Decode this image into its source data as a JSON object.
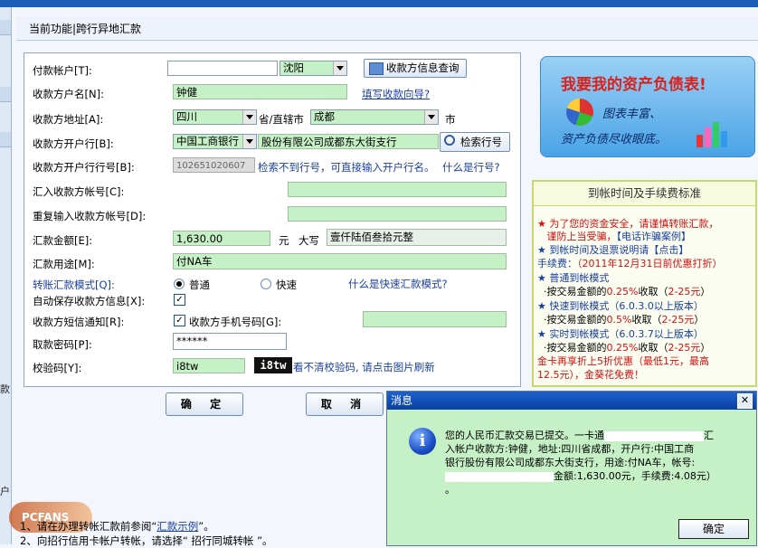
{
  "header": {
    "breadcrumb": "当前功能|跨行异地汇款"
  },
  "left_glyphs": [
    "款",
    "户"
  ],
  "form": {
    "payer_account": {
      "label": "付款帐户[T]:",
      "city": "沈阳",
      "query_button": "收款方信息查询"
    },
    "payee_name": {
      "label": "收款方户名[N]:",
      "value": "钟健",
      "link": "填写收款向导?"
    },
    "payee_address": {
      "label": "收款方地址[A]:",
      "province": "四川",
      "province_suffix": "省/直辖市",
      "city": "成都",
      "city_suffix": "市"
    },
    "payee_bank": {
      "label": "收款方开户行[B]:",
      "bank": "中国工商银行",
      "branch": "股份有限公司成都东大街支行",
      "search_button": "检索行号"
    },
    "payee_bank_no": {
      "label": "收款方开户行行号[B]:",
      "value": "102651020607",
      "hint": "检索不到行号，可直接输入开户行名。",
      "link": "什么是行号?"
    },
    "account_no": {
      "label": "汇入收款方帐号[C]:"
    },
    "account_no_repeat": {
      "label": "重复输入收款方帐号[D]:"
    },
    "amount": {
      "label": "汇款金额[E]:",
      "value": "1,630.00",
      "unit": "元",
      "daxie_label": "大写",
      "daxie_value": "壹仟陆佰叁拾元整"
    },
    "purpose": {
      "label": "汇款用途[M]:",
      "value": "付NA车"
    },
    "mode": {
      "label": "转账汇款模式[Q]:",
      "normal": "普通",
      "fast": "快速",
      "link": "什么是快速汇款模式?"
    },
    "autosave": {
      "label": "自动保存收款方信息[X]:"
    },
    "sms": {
      "label": "收款方短信通知[R]:",
      "phone_label": "收款方手机号码[G]:"
    },
    "password": {
      "label": "取款密码[P]:",
      "value": "******"
    },
    "captcha": {
      "label": "校验码[Y]:",
      "value": "i8tw",
      "image_text": "i8tw",
      "hint": "看不清校验码, 请点击图片刷新"
    },
    "confirm_button": "确 定",
    "cancel_button": "取 消"
  },
  "ad": {
    "headline": "我要我的资产负债表!",
    "line1": "图表丰富、",
    "line2": "资产负债尽收眼底。"
  },
  "fee_box": {
    "title": "到帐时间及手续费标准",
    "lines": [
      "为了您的资金安全，请谨慎转账汇款，",
      "谨防上当受骗，",
      "【电话诈骗案例】",
      "到帐时间及退票说明请",
      "【点击】",
      "手续费：",
      "（2011年12月31日前优惠打折）",
      "普通到帐模式",
      "·按交易金额的",
      "0.25%",
      "收取（",
      "2-25元",
      "）",
      "快速到帐模式",
      "（6.0.3.0以上版本）",
      "0.5%",
      "实时到帐模式",
      "（6.0.3.7以上版本）",
      "金卡再享折上5折优惠（最低1元，最高",
      "12.5元），金葵花免费！"
    ]
  },
  "message": {
    "title": "消息",
    "line1": "您的人民币汇款交易已提交。一卡通",
    "line1_end": "汇",
    "line2": "入帐户",
    "line2_b": "收款方:钟健，地址:四川省成都，开户行:中国工商",
    "line3": "银行股份有限公司成都东大街支行，用途:付NA车，帐号:",
    "line4": "金额:1,630.00元，手续费:4.08元）",
    "line5": "。",
    "ok": "确定"
  },
  "footer": {
    "line1_prefix": "1、请在办理转帐汇款前参阅“",
    "line1_link": "汇款示例",
    "line1_suffix": "”。",
    "line2": "2、向招行信用卡帐户转帐，请选择“ 招行同城转帐 ”。",
    "watermark": "PCFANS"
  }
}
